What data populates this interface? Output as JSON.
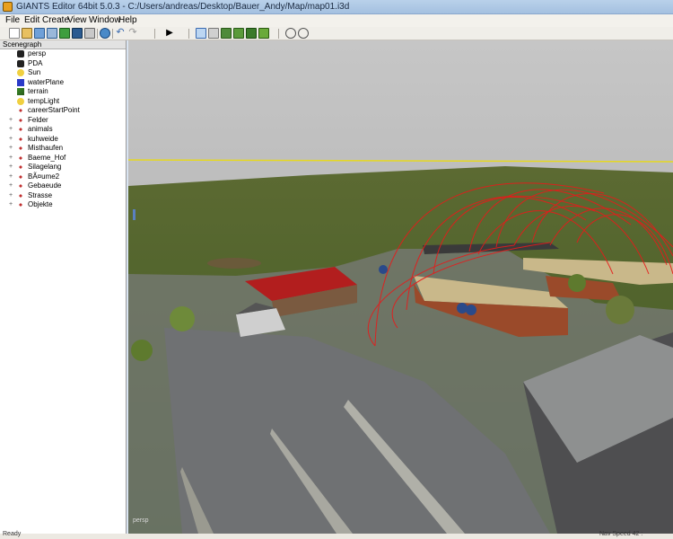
{
  "window": {
    "title": "GIANTS Editor 64bit 5.0.3 - C:/Users/andreas/Desktop/Bauer_Andy/Map/map01.i3d"
  },
  "menu": [
    "File",
    "Edit",
    "Create",
    "View",
    "Window",
    "Help"
  ],
  "panel": {
    "title": "Scenegraph"
  },
  "scenegraph": [
    {
      "label": "persp",
      "icon": "camera-icon",
      "level": 1
    },
    {
      "label": "PDA",
      "icon": "camera-icon",
      "level": 1
    },
    {
      "label": "Sun",
      "icon": "light-bulb-icon",
      "level": 1
    },
    {
      "label": "waterPlane",
      "icon": "cube-icon",
      "level": 1
    },
    {
      "label": "terrain",
      "icon": "terrain-icon",
      "level": 1
    },
    {
      "label": "tempLight",
      "icon": "light-bulb-icon",
      "level": 1
    },
    {
      "label": "careerStartPoint",
      "icon": "transform-group-icon",
      "level": 1
    },
    {
      "label": "Felder",
      "icon": "transform-group-icon",
      "level": 0
    },
    {
      "label": "animals",
      "icon": "transform-group-icon",
      "level": 0
    },
    {
      "label": "kuhweide",
      "icon": "transform-group-icon",
      "level": 0
    },
    {
      "label": "Misthaufen",
      "icon": "transform-group-icon",
      "level": 0
    },
    {
      "label": "Baeme_Hof",
      "icon": "transform-group-icon",
      "level": 0
    },
    {
      "label": "Silagelang",
      "icon": "transform-group-icon",
      "level": 0
    },
    {
      "label": "BÃ¤ume2",
      "icon": "transform-group-icon",
      "level": 0
    },
    {
      "label": "Gebaeude",
      "icon": "transform-group-icon",
      "level": 0
    },
    {
      "label": "Strasse",
      "icon": "transform-group-icon",
      "level": 0
    },
    {
      "label": "Objekte",
      "icon": "transform-group-icon",
      "level": 0
    }
  ],
  "viewport": {
    "camera_label": "persp"
  },
  "status": {
    "left": "Ready",
    "right": "Nav Speed 42 :"
  }
}
